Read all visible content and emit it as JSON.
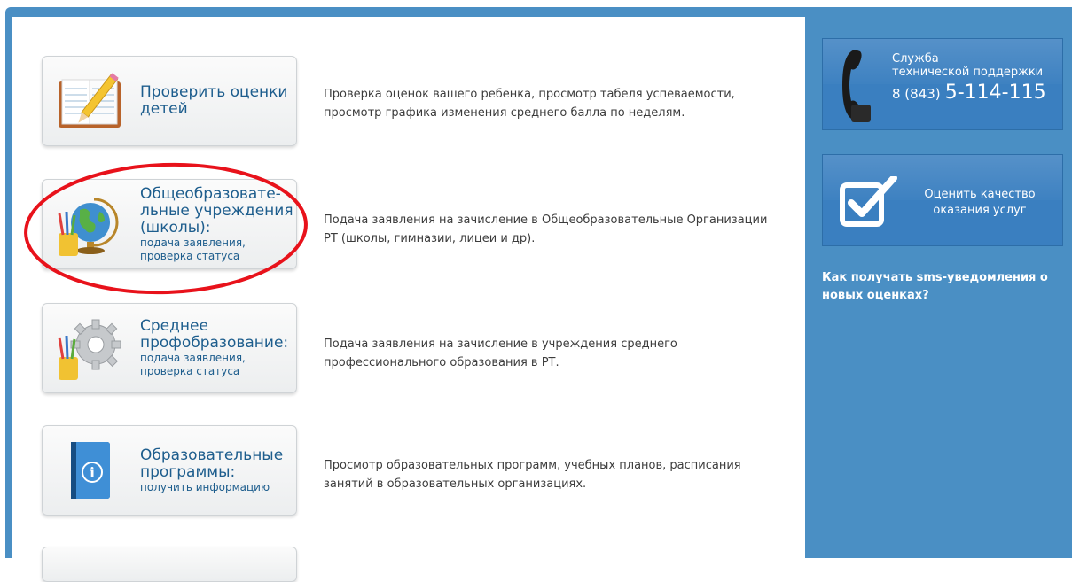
{
  "services": [
    {
      "title": "Проверить оценки детей",
      "sub": "",
      "icon": "gradebook-pencil-icon",
      "description": "Проверка оценок вашего ребенка, просмотр табеля успеваемости, просмотр графика изменения среднего балла по неделям."
    },
    {
      "title": "Общеобразовате-льные учреждения (школы):",
      "sub": "подача заявления, проверка статуса",
      "icon": "globe-pencils-icon",
      "description": "Подача заявления на зачисление в Общеобразовательные Организации РТ (школы, гимназии, лицеи и др)."
    },
    {
      "title": "Среднее профобразование:",
      "sub": "подача заявления, проверка статуса",
      "icon": "gear-pencils-icon",
      "description": "Подача заявления на зачисление в учреждения среднего профессионального образования в РТ."
    },
    {
      "title": "Образовательные программы:",
      "sub": "получить информацию",
      "icon": "info-book-icon",
      "description": "Просмотр образовательных программ, учебных планов, расписания занятий в образовательных организациях."
    }
  ],
  "sidebar": {
    "support": {
      "line1": "Служба",
      "line2": "технической поддержки",
      "phone_prefix": "8 (843)",
      "phone_number": "5-114-115",
      "icon": "telephone-handset-icon"
    },
    "rate": {
      "line1": "Оценить качество",
      "line2": "оказания услуг",
      "icon": "checkbox-icon"
    },
    "sms_link": "Как получать sms-уведомления о новых оценках?"
  },
  "colors": {
    "sidebar_bg": "#4a8fc4",
    "button_text": "#1d5d8d",
    "highlight_ellipse": "#e8121b"
  }
}
